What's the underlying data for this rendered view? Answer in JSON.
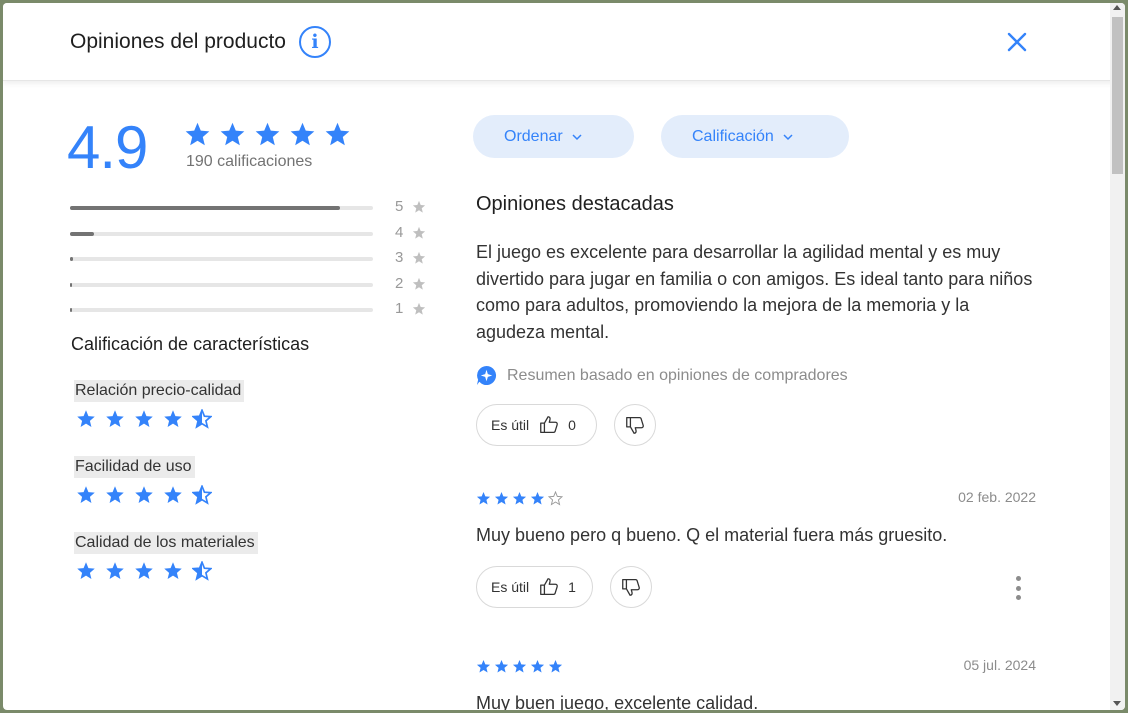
{
  "header": {
    "title": "Opiniones del producto",
    "info_icon": "info-icon",
    "close_icon": "close-icon"
  },
  "colors": {
    "accent": "#3483fa",
    "pill_bg": "#e3edfb",
    "bar_fill": "#737373"
  },
  "summary_rating": {
    "average": "4.9",
    "stars": 5,
    "count_label": "190 calificaciones",
    "distribution": [
      {
        "label": "5",
        "fraction": 0.89
      },
      {
        "label": "4",
        "fraction": 0.08
      },
      {
        "label": "3",
        "fraction": 0.01
      },
      {
        "label": "2",
        "fraction": 0.005
      },
      {
        "label": "1",
        "fraction": 0.005
      }
    ]
  },
  "features": {
    "title": "Calificación de características",
    "items": [
      {
        "label": "Relación precio-calidad",
        "rating": 4.5
      },
      {
        "label": "Facilidad de uso",
        "rating": 4.5
      },
      {
        "label": "Calidad de los materiales",
        "rating": 4.5
      }
    ]
  },
  "filters": {
    "sort_label": "Ordenar",
    "rating_label": "Calificación"
  },
  "featured": {
    "title": "Opiniones destacadas",
    "summary": "El juego es excelente para desarrollar la agilidad mental y es muy divertido para jugar en familia o con amigos. Es ideal tanto para niños como para adultos, promoviendo la mejora de la memoria y la agudeza mental.",
    "ai_note": "Resumen basado en opiniones de compradores",
    "useful_label": "Es útil",
    "useful_count": "0"
  },
  "reviews": [
    {
      "rating": 4,
      "date": "02 feb. 2022",
      "text": "Muy bueno pero q bueno. Q el material fuera más gruesito.",
      "useful_label": "Es útil",
      "useful_count": "1"
    },
    {
      "rating": 5,
      "date": "05 jul. 2024",
      "text": "Muy buen juego, excelente calidad."
    }
  ]
}
